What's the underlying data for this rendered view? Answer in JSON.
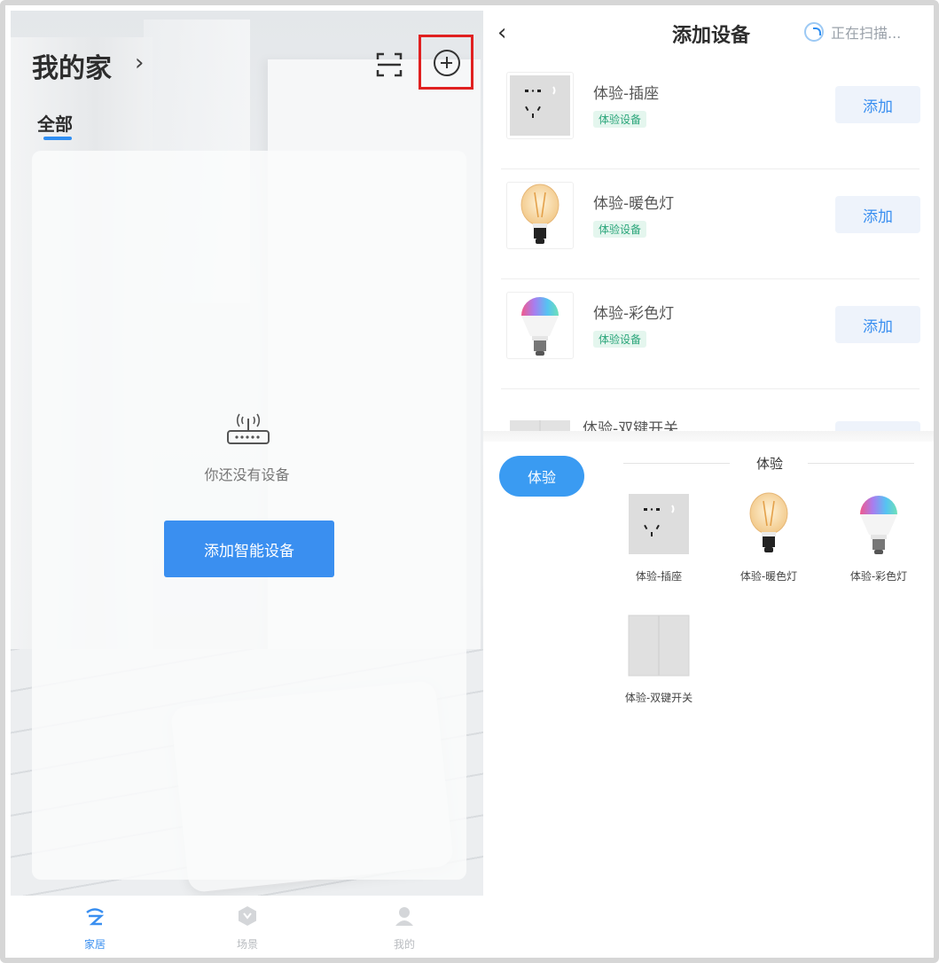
{
  "left": {
    "title": "我的家",
    "chevron": "›",
    "tab_all": "全部",
    "empty_text": "你还没有设备",
    "add_smart_device": "添加智能设备",
    "bottom_nav": [
      {
        "label": "家居",
        "icon": "home-cloud-icon",
        "active": true
      },
      {
        "label": "场景",
        "icon": "scene-icon",
        "active": false
      },
      {
        "label": "我的",
        "icon": "profile-icon",
        "active": false
      }
    ]
  },
  "right": {
    "back": "‹",
    "title": "添加设备",
    "scan_status": "正在扫描...",
    "devices": [
      {
        "name": "体验-插座",
        "tag": "体验设备",
        "add": "添加",
        "icon": "socket-icon"
      },
      {
        "name": "体验-暖色灯",
        "tag": "体验设备",
        "add": "添加",
        "icon": "warm-bulb-icon"
      },
      {
        "name": "体验-彩色灯",
        "tag": "体验设备",
        "add": "添加",
        "icon": "color-bulb-icon"
      },
      {
        "name": "体验-双键开关",
        "tag": "",
        "add": "",
        "icon": "double-switch-icon"
      }
    ],
    "category_button": "体验",
    "section_title": "体验",
    "grid": [
      {
        "label": "体验-插座",
        "icon": "socket-icon"
      },
      {
        "label": "体验-暖色灯",
        "icon": "warm-bulb-icon"
      },
      {
        "label": "体验-彩色灯",
        "icon": "color-bulb-icon"
      },
      {
        "label": "体验-双键开关",
        "icon": "double-switch-icon"
      }
    ]
  },
  "colors": {
    "accent": "#3a8ff0",
    "highlight_box": "#e02020",
    "tag_text": "#2aa57a",
    "tag_bg": "#e4f6ee"
  }
}
